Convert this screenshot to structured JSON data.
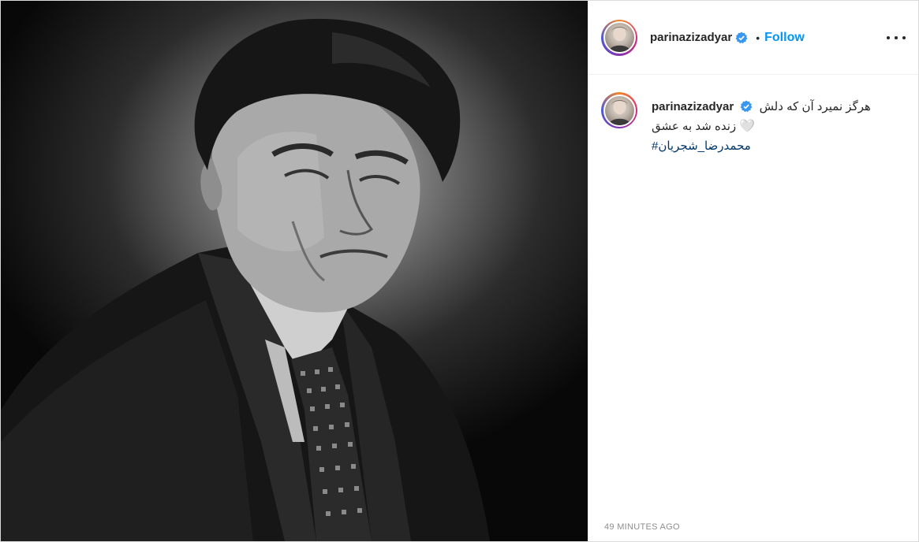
{
  "post": {
    "author": {
      "username": "parinazizadyar",
      "verified": true,
      "avatar_icon": "user-avatar"
    },
    "follow_label": "Follow",
    "separator": "•",
    "more_icon": "ellipsis-icon",
    "caption": {
      "username": "parinazizadyar",
      "line1": "هرگز نمیرد آن که دلش",
      "line2": "زنده شد به عشق",
      "heart": "🤍",
      "hashtag": "#محمدرضا_شجریان"
    },
    "timestamp": "49 MINUTES AGO",
    "media": {
      "description_icon": "portrait-photo"
    }
  },
  "colors": {
    "link_blue": "#0095f6",
    "hashtag_blue": "#00376b",
    "muted": "#8e8e8e",
    "verified_blue": "#3897f0"
  }
}
